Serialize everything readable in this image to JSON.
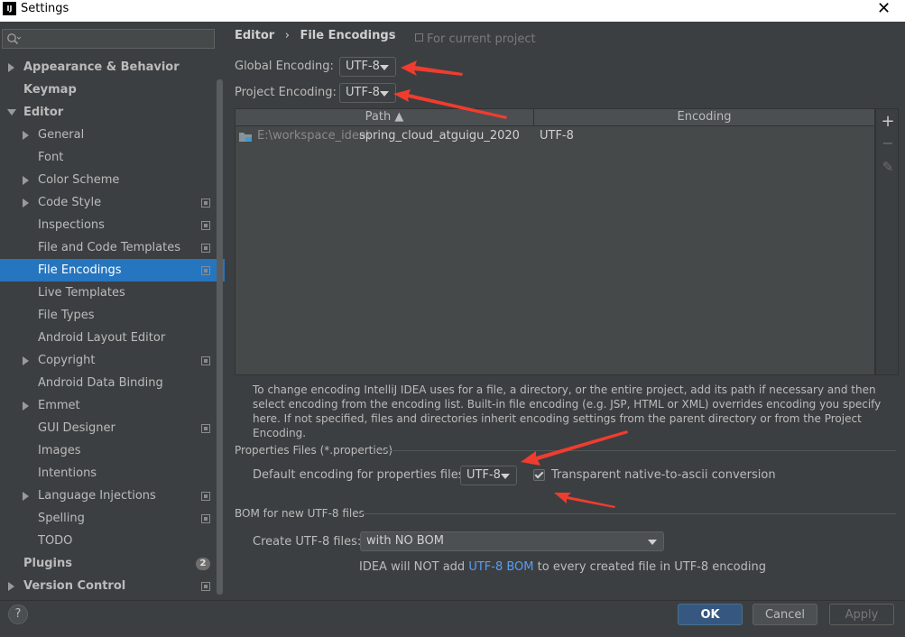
{
  "window": {
    "title": "Settings",
    "logo": "IJ"
  },
  "sidebar": {
    "search_placeholder": "",
    "items": [
      {
        "label": "Appearance & Behavior",
        "level": 0,
        "bold": true,
        "arrow": "right"
      },
      {
        "label": "Keymap",
        "level": 0,
        "bold": true,
        "arrow": ""
      },
      {
        "label": "Editor",
        "level": 0,
        "bold": true,
        "arrow": "down"
      },
      {
        "label": "General",
        "level": 1,
        "arrow": "right"
      },
      {
        "label": "Font",
        "level": 1,
        "arrow": ""
      },
      {
        "label": "Color Scheme",
        "level": 1,
        "arrow": "right"
      },
      {
        "label": "Code Style",
        "level": 1,
        "arrow": "right",
        "project": true
      },
      {
        "label": "Inspections",
        "level": 1,
        "arrow": "",
        "project": true
      },
      {
        "label": "File and Code Templates",
        "level": 1,
        "arrow": "",
        "project": true
      },
      {
        "label": "File Encodings",
        "level": 1,
        "arrow": "",
        "project": true,
        "selected": true
      },
      {
        "label": "Live Templates",
        "level": 1,
        "arrow": ""
      },
      {
        "label": "File Types",
        "level": 1,
        "arrow": ""
      },
      {
        "label": "Android Layout Editor",
        "level": 1,
        "arrow": ""
      },
      {
        "label": "Copyright",
        "level": 1,
        "arrow": "right",
        "project": true
      },
      {
        "label": "Android Data Binding",
        "level": 1,
        "arrow": ""
      },
      {
        "label": "Emmet",
        "level": 1,
        "arrow": "right"
      },
      {
        "label": "GUI Designer",
        "level": 1,
        "arrow": "",
        "project": true
      },
      {
        "label": "Images",
        "level": 1,
        "arrow": ""
      },
      {
        "label": "Intentions",
        "level": 1,
        "arrow": ""
      },
      {
        "label": "Language Injections",
        "level": 1,
        "arrow": "right",
        "project": true
      },
      {
        "label": "Spelling",
        "level": 1,
        "arrow": "",
        "project": true
      },
      {
        "label": "TODO",
        "level": 1,
        "arrow": ""
      },
      {
        "label": "Plugins",
        "level": 0,
        "bold": true,
        "arrow": "",
        "badge": "2"
      },
      {
        "label": "Version Control",
        "level": 0,
        "bold": true,
        "arrow": "right",
        "project": true
      }
    ]
  },
  "breadcrumb": {
    "parent": "Editor",
    "sep": "›",
    "current": "File Encodings"
  },
  "for_current_project": "For current project",
  "global_encoding": {
    "label": "Global Encoding:",
    "value": "UTF-8"
  },
  "project_encoding": {
    "label": "Project Encoding:",
    "value": "UTF-8"
  },
  "table": {
    "columns": [
      "Path ▲",
      "Encoding"
    ],
    "rows": [
      {
        "path_prefix": "E:\\workspace_idea\\",
        "path_name": "spring_cloud_atguigu_2020",
        "encoding": "UTF-8"
      }
    ]
  },
  "toolbar": {
    "add": "+",
    "remove": "−",
    "edit": "✎"
  },
  "description": "To change encoding IntelliJ IDEA uses for a file, a directory, or the entire project, add its path if necessary and then select encoding from the encoding list. Built-in file encoding (e.g. JSP, HTML or XML) overrides encoding you specify here. If not specified, files and directories inherit encoding settings from the parent directory or from the Project Encoding.",
  "properties": {
    "section": "Properties Files (*.properties)",
    "default_label": "Default encoding for properties files:",
    "default_value": "UTF-8",
    "ascii_label": "Transparent native-to-ascii conversion",
    "ascii_checked": true
  },
  "bom": {
    "section": "BOM for new UTF-8 files",
    "create_label": "Create UTF-8 files:",
    "create_value": "with NO BOM",
    "note_before": "IDEA will NOT add ",
    "note_link": "UTF-8 BOM",
    "note_after": " to every created file in UTF-8 encoding"
  },
  "buttons": {
    "help": "?",
    "ok": "OK",
    "cancel": "Cancel",
    "apply": "Apply"
  },
  "colors": {
    "accent": "#2675bf",
    "arrow": "#ff3b30",
    "link": "#589df6"
  }
}
